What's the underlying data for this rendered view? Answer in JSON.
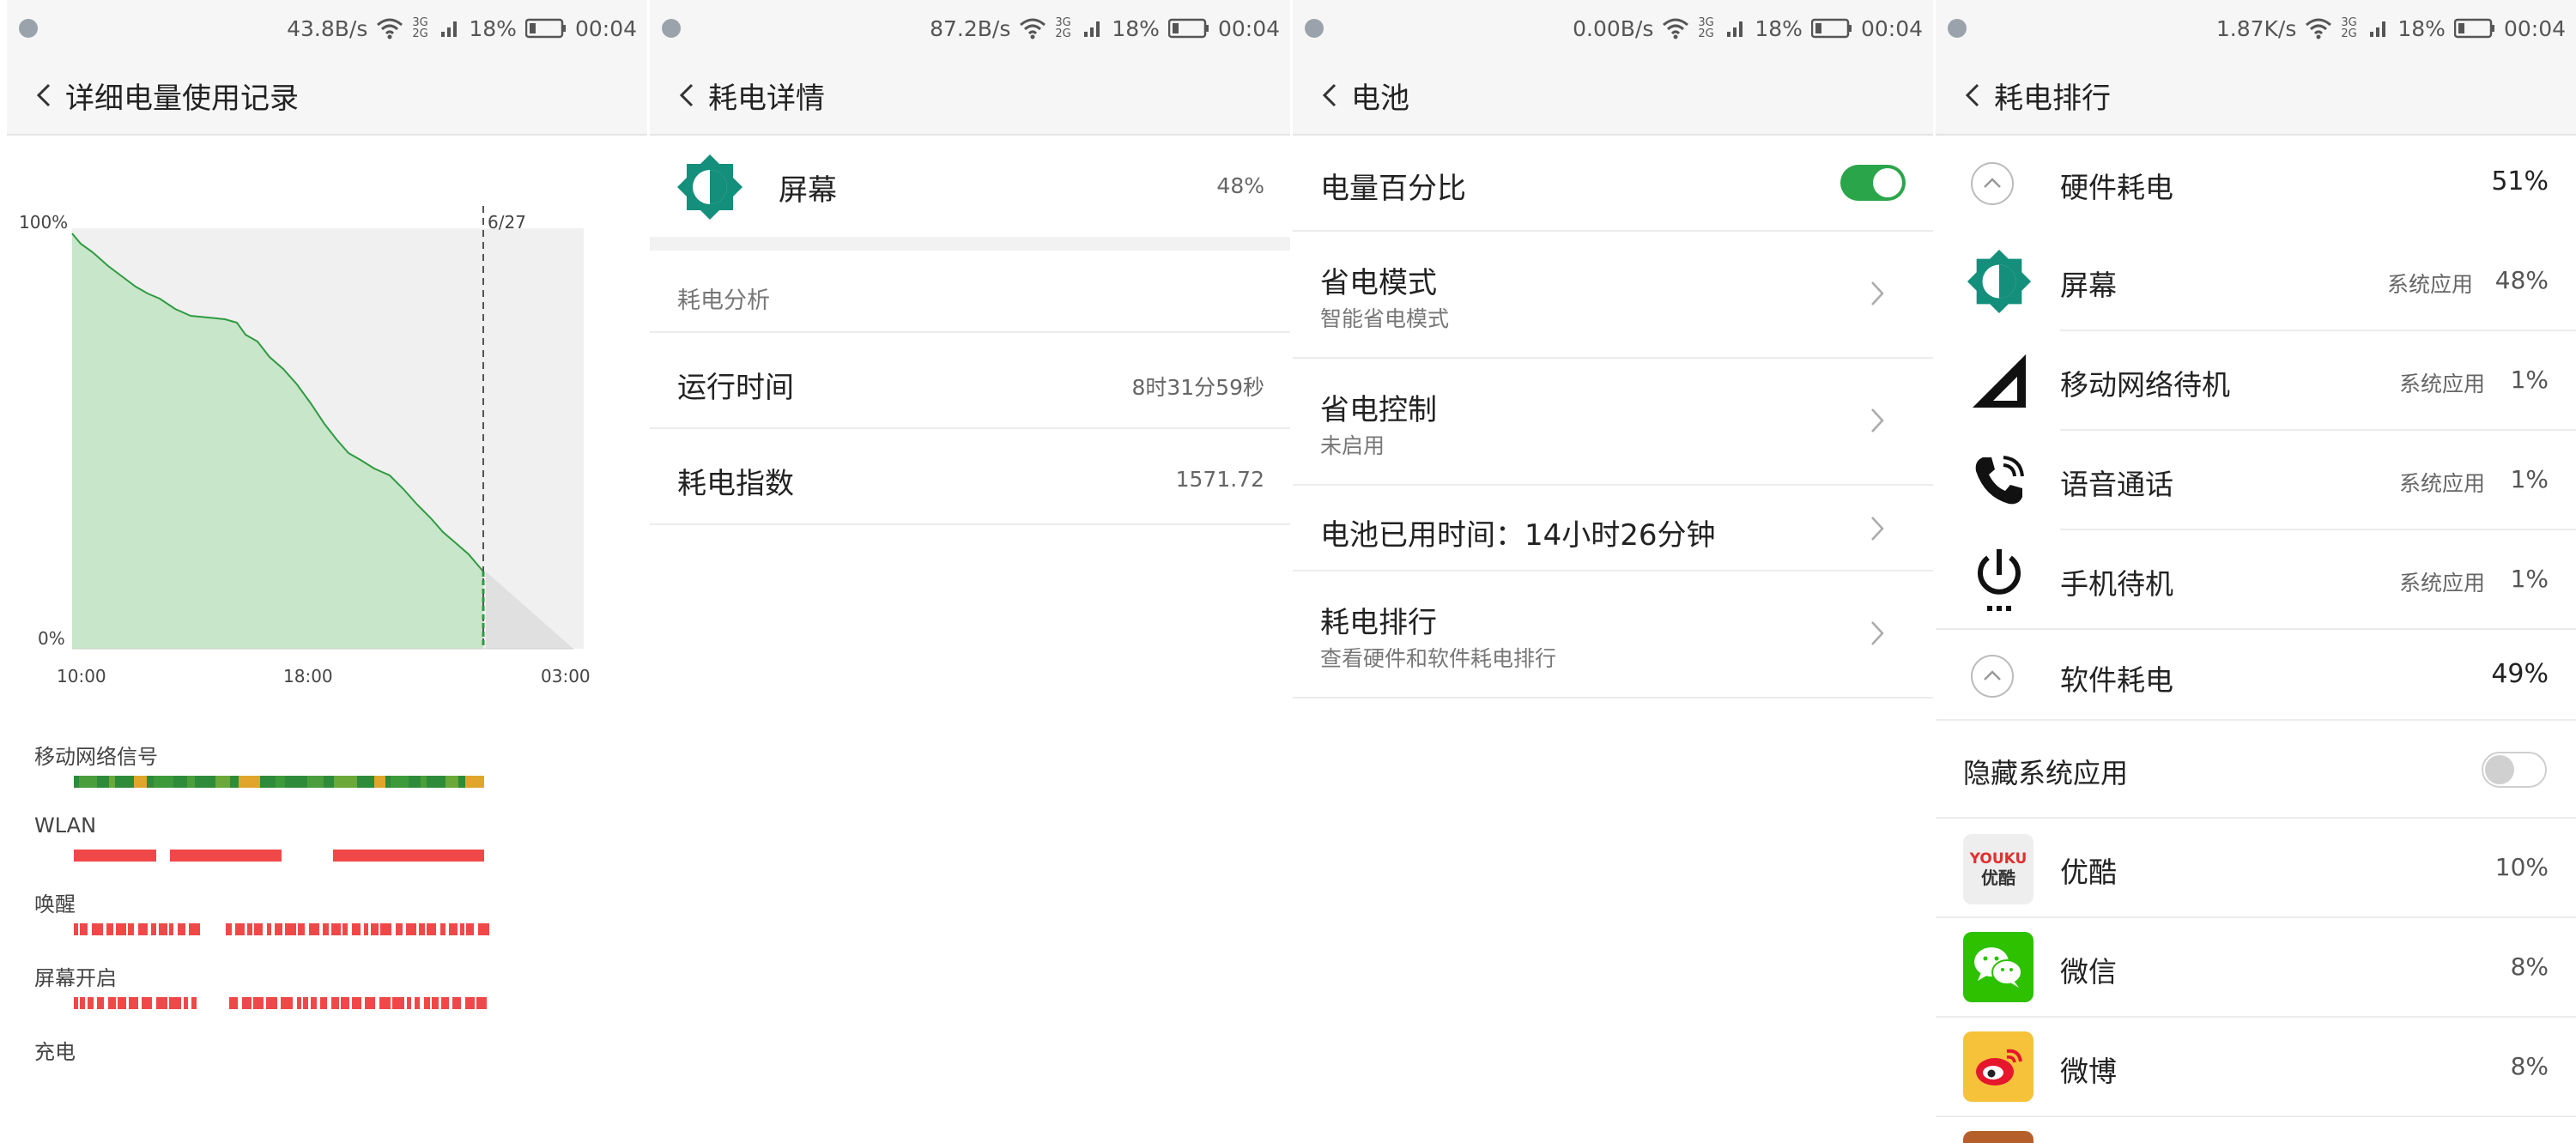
{
  "colors": {
    "accent": "#1aa57a",
    "chart_fill": "#c8e6c9",
    "chart_line": "#2e9b40",
    "red_bar": "#f04848",
    "green_dark": "#2e8b3a",
    "toggle_on": "#2aa54a",
    "toggle_off": "#cfcfcf"
  },
  "screens": [
    {
      "status": {
        "speed": "43.8B/s",
        "network": "3G 2G",
        "battery_pct": "18%",
        "time": "00:04"
      },
      "title": "详细电量使用记录",
      "chart": {
        "y_top": "100%",
        "y_bottom": "0%",
        "marker": "6/27",
        "x_ticks": [
          "10:00",
          "18:00",
          "03:00"
        ]
      },
      "tracks": [
        {
          "label": "移动网络信号"
        },
        {
          "label": "WLAN"
        },
        {
          "label": "唤醒"
        },
        {
          "label": "屏幕开启"
        },
        {
          "label": "充电"
        }
      ]
    },
    {
      "status": {
        "speed": "87.2B/s",
        "network": "3G 2G",
        "battery_pct": "18%",
        "time": "00:04"
      },
      "title": "耗电详情",
      "item": {
        "icon": "brightness-icon",
        "name": "屏幕",
        "pct": "48%"
      },
      "section": "耗电分析",
      "rows": [
        {
          "label": "运行时间",
          "value": "8时31分59秒"
        },
        {
          "label": "耗电指数",
          "value": "1571.72"
        }
      ]
    },
    {
      "status": {
        "speed": "0.00B/s",
        "network": "3G 2G",
        "battery_pct": "18%",
        "time": "00:04"
      },
      "title": "电池",
      "battery_percent": {
        "label": "电量百分比",
        "enabled": true
      },
      "rows": [
        {
          "label": "省电模式",
          "sub": "智能省电模式"
        },
        {
          "label": "省电控制",
          "sub": "未启用"
        },
        {
          "label": "电池已用时间：14小时26分钟",
          "sub": ""
        },
        {
          "label": "耗电排行",
          "sub": "查看硬件和软件耗电排行"
        }
      ]
    },
    {
      "status": {
        "speed": "1.87K/s",
        "network": "3G 2G",
        "battery_pct": "18%",
        "time": "00:04"
      },
      "title": "耗电排行",
      "hardware": {
        "label": "硬件耗电",
        "pct": "51%"
      },
      "hw_items": [
        {
          "icon": "brightness-icon",
          "name": "屏幕",
          "tag": "系统应用",
          "pct": "48%"
        },
        {
          "icon": "cell-signal-icon",
          "name": "移动网络待机",
          "tag": "系统应用",
          "pct": "1%"
        },
        {
          "icon": "phone-call-icon",
          "name": "语音通话",
          "tag": "系统应用",
          "pct": "1%"
        },
        {
          "icon": "power-icon",
          "name": "手机待机",
          "tag": "系统应用",
          "pct": "1%"
        }
      ],
      "software": {
        "label": "软件耗电",
        "pct": "49%"
      },
      "hide_system": {
        "label": "隐藏系统应用",
        "enabled": false
      },
      "sw_items": [
        {
          "icon": "youku-icon",
          "icon_text": "YOUKU",
          "icon_sub": "优酷",
          "name": "优酷",
          "pct": "10%"
        },
        {
          "icon": "wechat-icon",
          "name": "微信",
          "pct": "8%"
        },
        {
          "icon": "weibo-icon",
          "name": "微博",
          "pct": "8%"
        }
      ]
    }
  ]
}
